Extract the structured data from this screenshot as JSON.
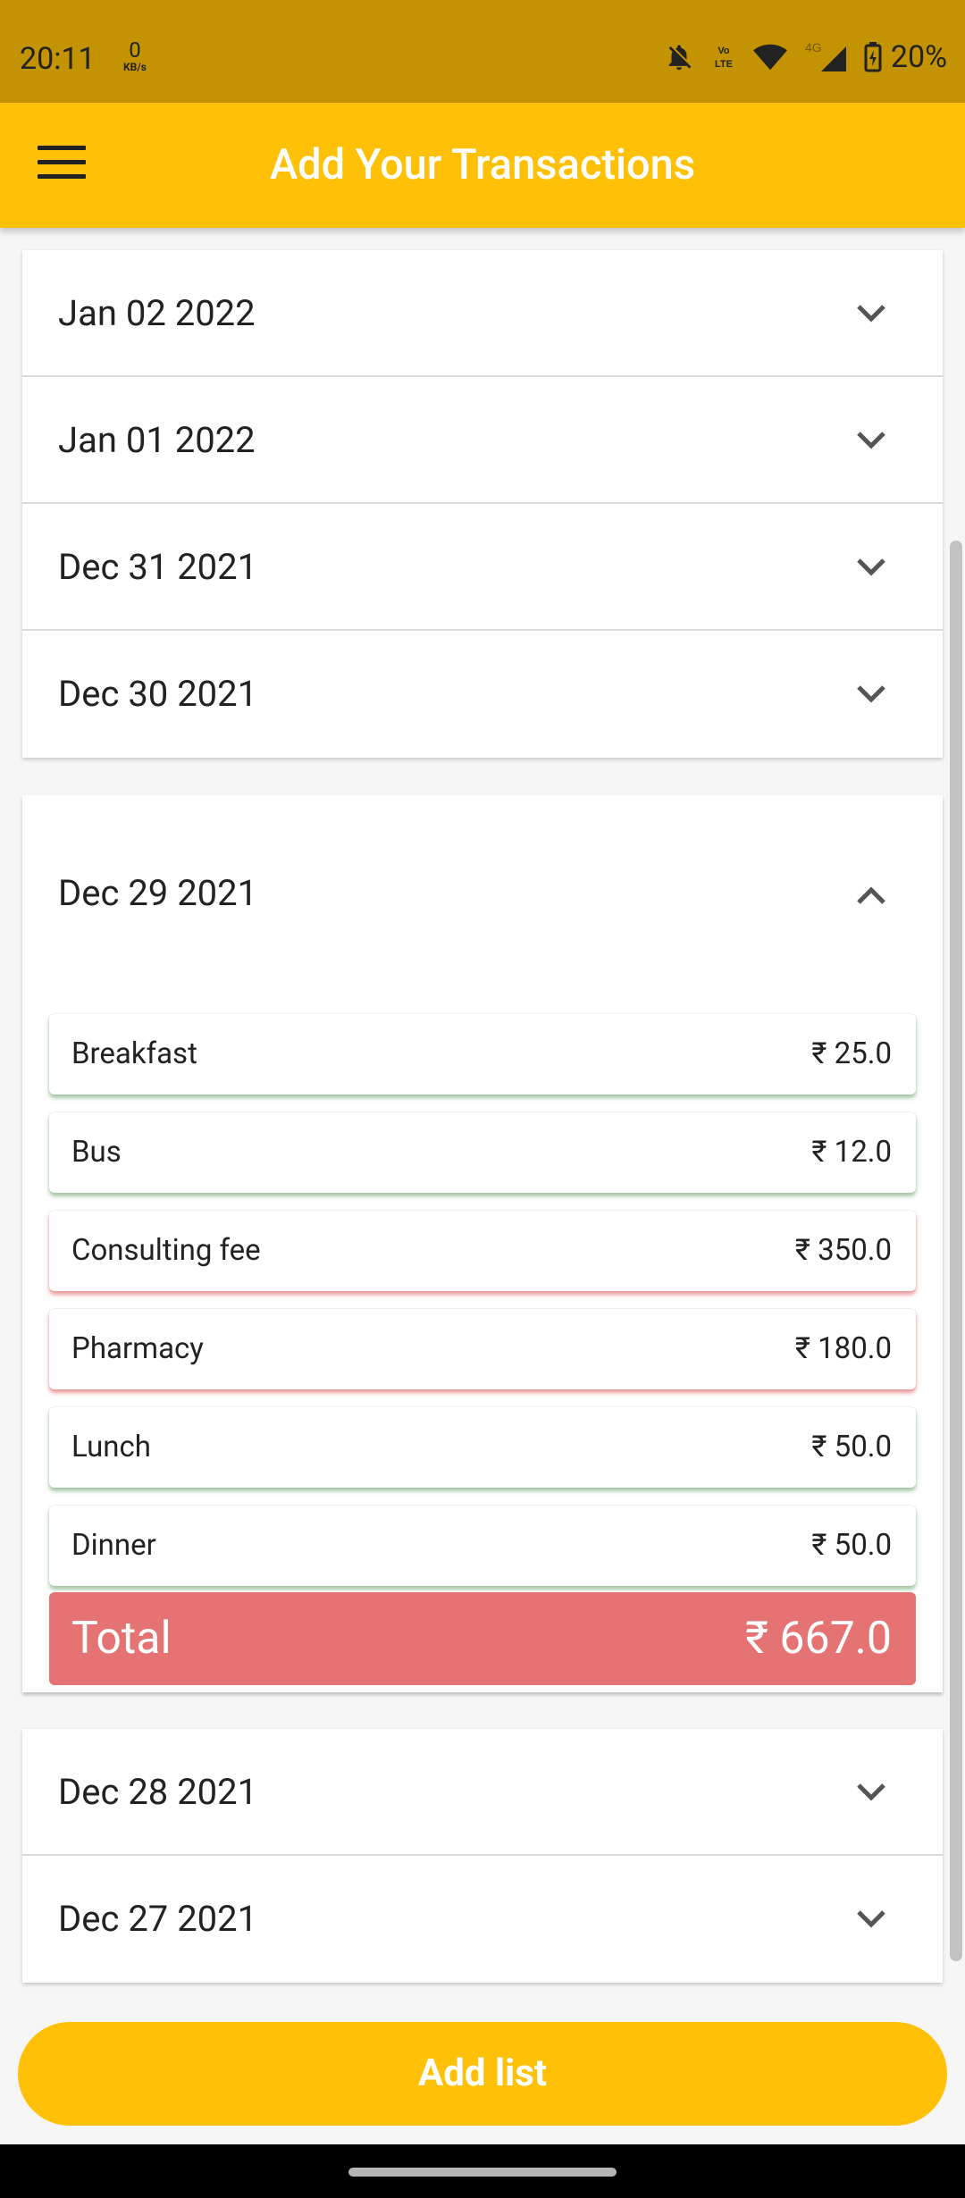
{
  "status_bar": {
    "time": "20:11",
    "net_speed_value": "0",
    "net_speed_unit": "KB/s",
    "network_badge": "Vo LTE",
    "signal_type": "4G",
    "battery": "20%"
  },
  "app_bar": {
    "title": "Add Your Transactions"
  },
  "date_groups_top": [
    {
      "date": "Jan 02 2022"
    },
    {
      "date": "Jan 01 2022"
    },
    {
      "date": "Dec 31 2021"
    },
    {
      "date": "Dec 30 2021"
    }
  ],
  "expanded_group": {
    "date": "Dec 29 2021",
    "transactions": [
      {
        "name": "Breakfast",
        "amount": "₹ 25.0",
        "type": "green"
      },
      {
        "name": "Bus",
        "amount": "₹ 12.0",
        "type": "green"
      },
      {
        "name": "Consulting fee",
        "amount": "₹ 350.0",
        "type": "red"
      },
      {
        "name": "Pharmacy",
        "amount": "₹ 180.0",
        "type": "red"
      },
      {
        "name": "Lunch",
        "amount": "₹ 50.0",
        "type": "green"
      },
      {
        "name": "Dinner",
        "amount": "₹ 50.0",
        "type": "green"
      }
    ],
    "total_label": "Total",
    "total_amount": "₹ 667.0"
  },
  "date_groups_bottom": [
    {
      "date": "Dec 28 2021"
    },
    {
      "date": "Dec 27 2021"
    }
  ],
  "add_button_label": "Add list",
  "colors": {
    "status_bar": "#c49302",
    "app_bar": "#ffc107",
    "total_bg": "#e57373",
    "income_shadow": "#74aa74",
    "expense_shadow": "#e27070"
  }
}
